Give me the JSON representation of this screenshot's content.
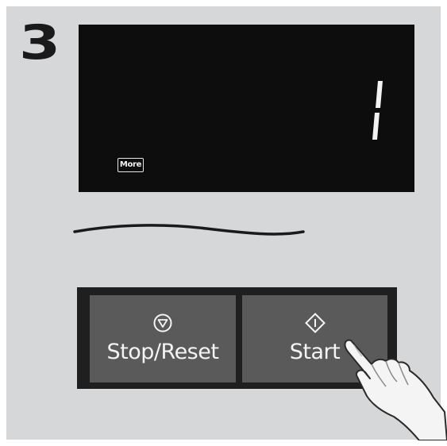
{
  "step": {
    "number": "3"
  },
  "display": {
    "readout": "1",
    "more_label": "More"
  },
  "buttons": {
    "stop_reset": {
      "label": "Stop/Reset",
      "icon": "stop-icon"
    },
    "start": {
      "label": "Start",
      "icon": "start-icon"
    }
  },
  "colors": {
    "background": "#d6d7d9",
    "display": "#0d0d0d",
    "button_frame": "#1f1f1f",
    "button_face": "#5a5a5a",
    "text_light": "#f4f4f4"
  }
}
